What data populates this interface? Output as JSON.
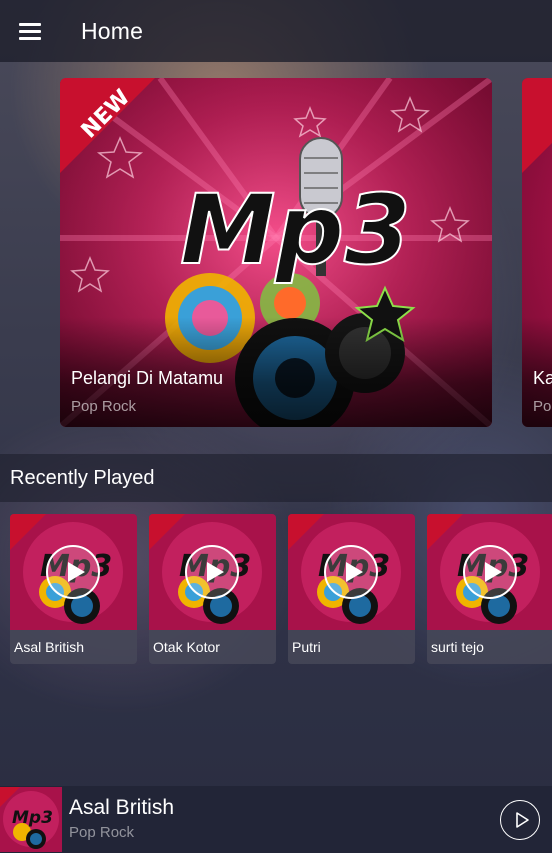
{
  "header": {
    "title": "Home",
    "menu_icon": "hamburger-menu-icon"
  },
  "featured": [
    {
      "title": "Pelangi Di Matamu",
      "genre": "Pop Rock",
      "badge": "NEW",
      "art_text": "Mp3"
    },
    {
      "title": "Ka",
      "genre": "Po"
    }
  ],
  "recent": {
    "heading": "Recently Played",
    "items": [
      {
        "label": "Asal British"
      },
      {
        "label": "Otak Kotor"
      },
      {
        "label": "Putri"
      },
      {
        "label": "surti tejo"
      }
    ]
  },
  "now_playing": {
    "title": "Asal British",
    "genre": "Pop Rock",
    "play_icon": "play-circle-icon"
  },
  "colors": {
    "art_primary": "#b0134c",
    "art_highlight": "#e23a78",
    "badge": "#c8102e",
    "bar_background": "#1c1e2a"
  }
}
